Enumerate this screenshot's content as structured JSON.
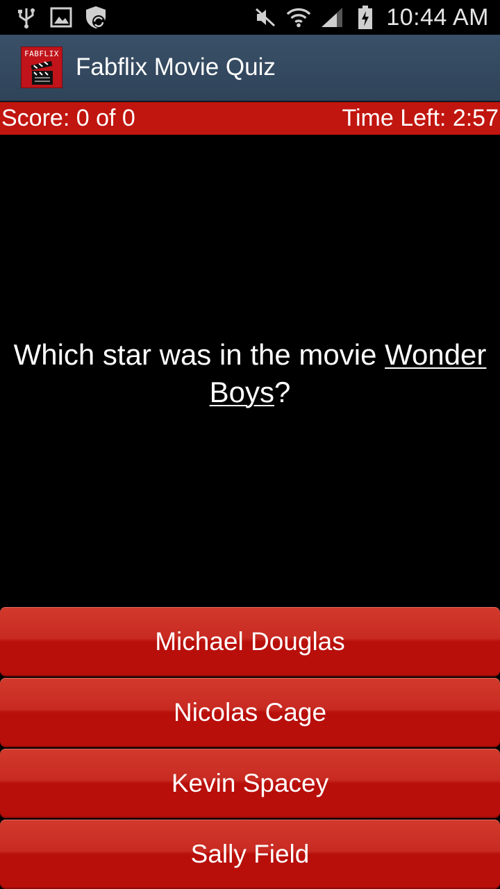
{
  "status_bar": {
    "time": "10:44 AM",
    "icons": [
      "usb-icon",
      "gallery-icon",
      "shield-sync-icon",
      "mute-icon",
      "wifi-icon",
      "signal-icon",
      "battery-charging-icon"
    ]
  },
  "action_bar": {
    "app_icon_text": "FABFLIX",
    "title": "Fabflix Movie Quiz"
  },
  "score_bar": {
    "score": "Score: 0 of 0",
    "time_left": "Time Left: 2:57"
  },
  "question": {
    "prefix": "Which star was in the movie ",
    "movie": "Wonder Boys",
    "suffix": "?"
  },
  "answers": [
    {
      "label": "Michael Douglas"
    },
    {
      "label": "Nicolas Cage"
    },
    {
      "label": "Kevin Spacey"
    },
    {
      "label": "Sally Field"
    }
  ],
  "colors": {
    "action_bar": "#34495e",
    "score_bar": "#c0160f",
    "answer_button": "#b80f0b",
    "background": "#000000"
  }
}
